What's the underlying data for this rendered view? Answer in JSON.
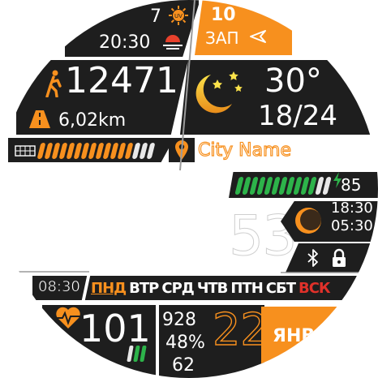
{
  "uv": {
    "value": "7"
  },
  "sunset": {
    "time": "20:30"
  },
  "wind": {
    "speed": "10",
    "direction": "ЗАП"
  },
  "steps": {
    "count": "12471",
    "distance": "6,02km"
  },
  "weather": {
    "temperature": "30°",
    "range": "18/24"
  },
  "progress": {
    "steps_fraction": 0.82
  },
  "location": {
    "city": "City Name"
  },
  "battery": {
    "percent": "85",
    "fraction": 0.85
  },
  "time": {
    "minutes": "53",
    "small": "08:30"
  },
  "moon": {
    "rise": "18:30",
    "set": "05:30"
  },
  "weekdays": {
    "labels": [
      "ПНД",
      "ВТР",
      "СРД",
      "ЧТВ",
      "ПТН",
      "СБТ",
      "ВСК"
    ],
    "active_index": 0
  },
  "heart": {
    "rate": "101"
  },
  "stats": {
    "calories": "928",
    "humidity": "48%",
    "other": "62"
  },
  "date": {
    "day": "22",
    "month": "ЯНВ"
  },
  "colors": {
    "accent": "#f7901e",
    "panel": "#1e1e1e",
    "battery_bar": "#2db34a",
    "sunday": "#e0312a",
    "progress_fill": "#f7901e"
  }
}
